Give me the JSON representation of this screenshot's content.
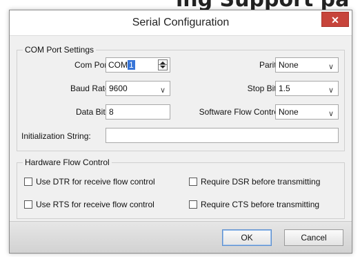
{
  "window": {
    "title": "Serial Configuration",
    "close_glyph": "✕",
    "background_title": "ing Support pa"
  },
  "com_group": {
    "label": "COM Port Settings",
    "com_port": {
      "label": "Com Port:",
      "prefix": "COM",
      "value": "1"
    },
    "baud_rate": {
      "label": "Baud Rate:",
      "value": "9600"
    },
    "data_bits": {
      "label": "Data Bits:",
      "value": "8"
    },
    "parity": {
      "label": "Parity:",
      "value": "None"
    },
    "stop_bits": {
      "label": "Stop Bits:",
      "value": "1.5"
    },
    "software_flow": {
      "label": "Software Flow Control:",
      "value": "None"
    },
    "init_string": {
      "label": "Initialization String:",
      "value": ""
    }
  },
  "hw_group": {
    "label": "Hardware Flow Control",
    "checkboxes": [
      {
        "label": "Use DTR for receive flow control",
        "checked": false
      },
      {
        "label": "Require DSR before transmitting",
        "checked": false
      },
      {
        "label": "Use RTS for receive flow control",
        "checked": false
      },
      {
        "label": "Require CTS before transmitting",
        "checked": false
      }
    ]
  },
  "buttons": {
    "ok": "OK",
    "cancel": "Cancel"
  },
  "icons": {
    "chevron": "chevron-down-icon",
    "spin": "spinner-arrows-icon",
    "close": "close-icon"
  },
  "colors": {
    "close_bg": "#c7443b",
    "selection": "#3875d7",
    "dialog_bg": "#f0f0f0"
  }
}
